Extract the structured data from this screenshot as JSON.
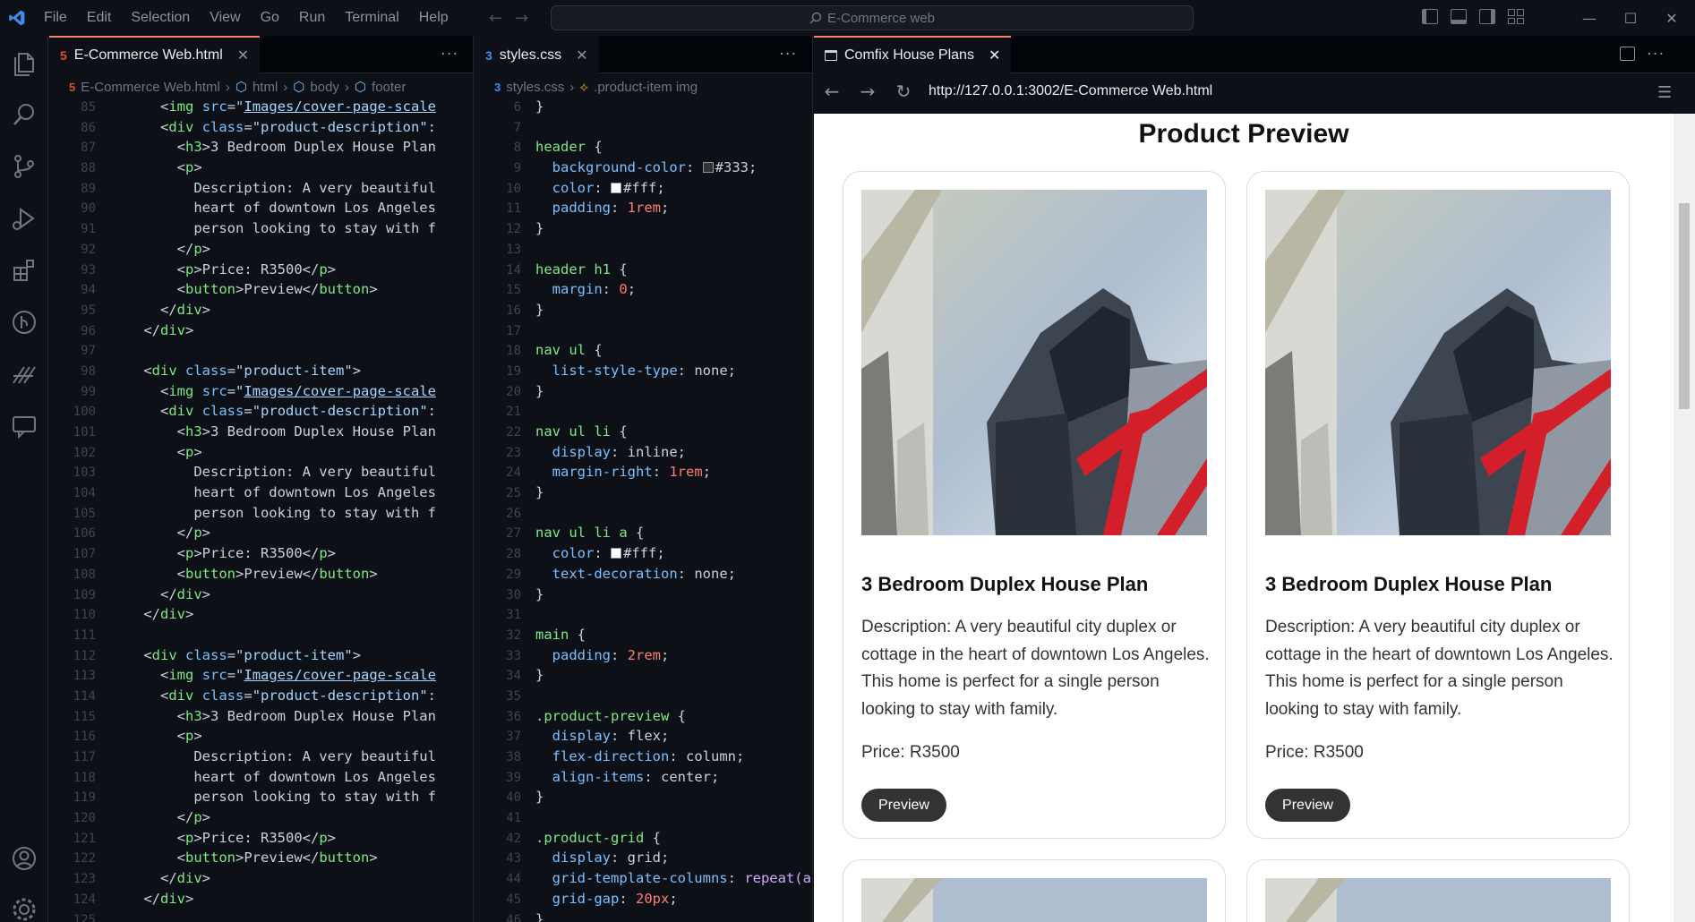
{
  "titlebar": {
    "menu": [
      "File",
      "Edit",
      "Selection",
      "View",
      "Go",
      "Run",
      "Terminal",
      "Help"
    ],
    "search_placeholder": "E-Commerce web"
  },
  "editor1": {
    "tab_label": "E-Commerce Web.html",
    "breadcrumb": [
      "E-Commerce Web.html",
      "html",
      "body",
      "footer"
    ],
    "line_numbers": [
      85,
      86,
      87,
      88,
      89,
      90,
      91,
      92,
      93,
      94,
      95,
      96,
      97,
      98,
      99,
      100,
      101,
      102,
      103,
      104,
      105,
      106,
      107,
      108,
      109,
      110,
      111,
      112,
      113,
      114,
      115,
      116,
      117,
      118,
      119,
      120,
      121,
      122,
      123,
      124,
      125
    ]
  },
  "editor2": {
    "tab_label": "styles.css",
    "breadcrumb": [
      "styles.css",
      ".product-item img"
    ],
    "line_numbers": [
      6,
      7,
      8,
      9,
      10,
      11,
      12,
      13,
      14,
      15,
      16,
      17,
      18,
      19,
      20,
      21,
      22,
      23,
      24,
      25,
      26,
      27,
      28,
      29,
      30,
      31,
      32,
      33,
      34,
      35,
      36,
      37,
      38,
      39,
      40,
      41,
      42,
      43,
      44,
      45,
      46
    ]
  },
  "browser": {
    "tab_label": "Comfix House Plans",
    "url": "http://127.0.0.1:3002/E-Commerce Web.html",
    "page_title": "Product Preview",
    "products": [
      {
        "title": "3 Bedroom Duplex House Plan",
        "description": "Description: A very beautiful city duplex or cottage in the heart of downtown Los Angeles. This home is perfect for a single person looking to stay with family.",
        "price": "Price: R3500",
        "button": "Preview"
      },
      {
        "title": "3 Bedroom Duplex House Plan",
        "description": "Description: A very beautiful city duplex or cottage in the heart of downtown Los Angeles. This home is perfect for a single person looking to stay with family.",
        "price": "Price: R3500",
        "button": "Preview"
      }
    ]
  },
  "colors": {
    "background": "#0d1117",
    "accent_tab": "#f78166",
    "vscode_blue": "#3b8eea",
    "button_dark": "#333333"
  }
}
